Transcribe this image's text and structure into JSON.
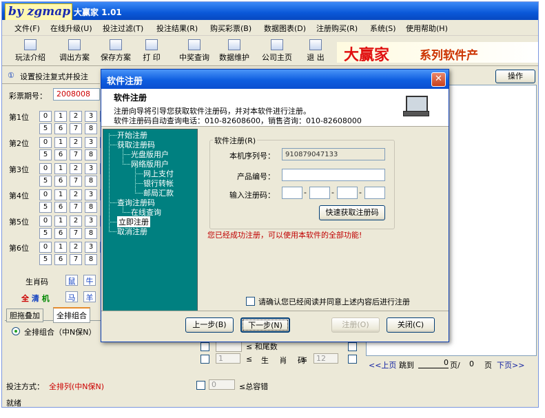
{
  "app": {
    "title": "大赢家 1.01",
    "watermark": "by zgmap"
  },
  "menu": [
    "文件(F)",
    "在线升级(U)",
    "投注过滤(T)",
    "投注结果(R)",
    "购买彩票(B)",
    "数据图表(D)",
    "注册购买(R)",
    "系统(S)",
    "使用帮助(H)"
  ],
  "toolbar": [
    "玩法介绍",
    "调出方案",
    "保存方案",
    "打 印",
    "中奖查询",
    "数据维护",
    "公司主页",
    "退 出"
  ],
  "brand": {
    "logo": "大赢家",
    "text": "系列软件产"
  },
  "left": {
    "header": "设置投注复式并投注",
    "period_label": "彩票期号：",
    "period_value": "2008008",
    "positions": [
      "第1位",
      "第2位",
      "第3位",
      "第4位",
      "第5位",
      "第6位"
    ],
    "digits_row1": [
      "0",
      "1",
      "2",
      "3",
      "4"
    ],
    "digits_row2": [
      "5",
      "6",
      "7",
      "8"
    ],
    "zodiac_label": "生肖码",
    "zodiac_values": [
      "鼠",
      "牛",
      "马",
      "羊"
    ],
    "clear_all": "全清机",
    "tabs": [
      "胆拖叠加",
      "全排组合"
    ],
    "radio_label": "全排组合（中N保N）",
    "bet_method_label": "投注方式：",
    "bet_method_value": "全排列(中N保N)",
    "status": "就绪"
  },
  "right": {
    "op_button": "操作",
    "pager": {
      "prev": "<<上页",
      "jump": "跳到",
      "page_value": "0",
      "page_unit": "页/",
      "total": "0",
      "total_unit": "页",
      "next": "下页>>"
    }
  },
  "middle": {
    "row1_value": "1",
    "row1_sign": "≤",
    "row1_label": "和 尾 数",
    "row2_value": "1",
    "row2_sign": "≤",
    "row2_label": "生 肖 码",
    "row2_right": "12",
    "row3_value": "0",
    "row3_label": "≤总容错"
  },
  "dialog": {
    "title": "软件注册",
    "heading": "软件注册",
    "desc1": "注册向导将引导您获取软件注册码，并对本软件进行注册。",
    "desc2": "软件注册码自动查询电话：010-82608600，销售咨询：010-82608000",
    "nav": [
      "开始注册",
      "获取注册码",
      "光盘版用户",
      "网络版用户",
      "网上支付",
      "银行转帐",
      "邮局汇款",
      "查询注册码",
      "在线查询",
      "立即注册",
      "取消注册"
    ],
    "group_title": "软件注册(R)",
    "serial_label": "本机序列号：",
    "serial_value": "910879047133",
    "product_label": "产品编号：",
    "product_value": "",
    "code_label": "输入注册码：",
    "dash": "-",
    "quick_btn": "快速获取注册码",
    "success_msg": "您已经成功注册，可以使用本软件的全部功能!",
    "agree_label": "请确认您已经阅读并同意上述内容后进行注册",
    "buttons": {
      "prev": "上一步(B)",
      "next": "下一步(N)",
      "register": "注册(O)",
      "close": "关闭(C)"
    }
  }
}
